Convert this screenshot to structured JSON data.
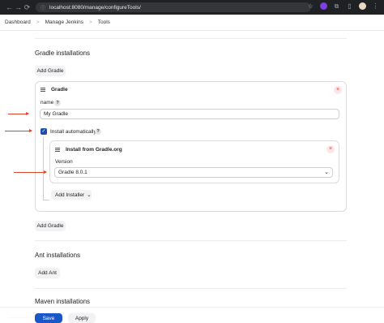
{
  "browser": {
    "url": "localhost:8080/manage/configureTools/",
    "back_icon": "arrow-left-icon",
    "forward_icon": "arrow-right-icon",
    "reload_icon": "reload-icon"
  },
  "breadcrumb": {
    "items": [
      "Dashboard",
      "Manage Jenkins",
      "Tools"
    ],
    "separator": ">"
  },
  "gradle": {
    "section_title": "Gradle installations",
    "add_button": "Add Gradle",
    "card": {
      "title": "Gradle",
      "name_label": "name",
      "name_value": "My Gradle",
      "install_auto_label": "Install automatically",
      "install_auto_checked": true,
      "installer": {
        "title": "Install from Gradle.org",
        "version_label": "Version",
        "version_value": "Gradle 8.0.1"
      },
      "add_installer_button": "Add Installer"
    },
    "add_button_bottom": "Add Gradle"
  },
  "ant": {
    "section_title": "Ant installations",
    "add_button": "Add Ant"
  },
  "maven": {
    "section_title": "Maven installations"
  },
  "footer": {
    "save": "Save",
    "apply": "Apply"
  },
  "help_glyph": "?",
  "close_glyph": "×",
  "check_glyph": "✓",
  "colors": {
    "primary": "#1a57c9",
    "annotation_arrow": "#e0452b",
    "close": "#e53935"
  }
}
